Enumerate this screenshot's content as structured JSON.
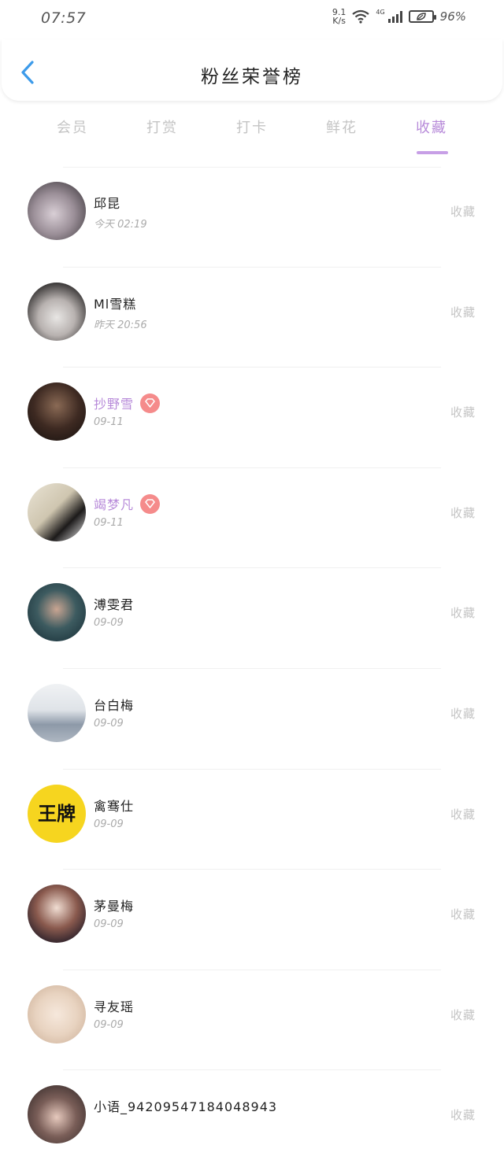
{
  "status_bar": {
    "time": "07:57",
    "net_speed_top": "9.1",
    "net_speed_bottom": "K/s",
    "network": "4G",
    "battery": "96%"
  },
  "header": {
    "title": "粉丝荣誉榜",
    "back_icon": "chevron-left-icon"
  },
  "tabs": [
    {
      "label": "会员"
    },
    {
      "label": "打赏"
    },
    {
      "label": "打卡"
    },
    {
      "label": "鲜花"
    },
    {
      "label": "收藏"
    }
  ],
  "active_tab": "收藏",
  "colors": {
    "accent": "#b78ad9",
    "badge": "#f58b8b",
    "back": "#3d9bea"
  },
  "list": [
    {
      "name": "邱昆",
      "time": "今天 02:19",
      "action": "收藏",
      "vip": false,
      "avatar_color": "#8a8090"
    },
    {
      "name": "Ml雪糕",
      "time": "昨天 20:56",
      "action": "收藏",
      "vip": false,
      "avatar_color": "#6f6a6a"
    },
    {
      "name": "抄野雪",
      "time": "09-11",
      "action": "收藏",
      "vip": true,
      "avatar_color": "#3a2b22"
    },
    {
      "name": "竭梦凡",
      "time": "09-11",
      "action": "收藏",
      "vip": true,
      "avatar_color": "#cfc8b8"
    },
    {
      "name": "溥雯君",
      "time": "09-09",
      "action": "收藏",
      "vip": false,
      "avatar_color": "#1f3a44"
    },
    {
      "name": "台白梅",
      "time": "09-09",
      "action": "收藏",
      "vip": false,
      "avatar_color": "#c8ced8"
    },
    {
      "name": "禽骞仕",
      "time": "09-09",
      "action": "收藏",
      "vip": false,
      "avatar_color": "#f6d51f"
    },
    {
      "name": "茅曼梅",
      "time": "09-09",
      "action": "收藏",
      "vip": false,
      "avatar_color": "#8a5a4e"
    },
    {
      "name": "寻友瑶",
      "time": "09-09",
      "action": "收藏",
      "vip": false,
      "avatar_color": "#e8d3c0"
    },
    {
      "name": "小语_94209547184048943",
      "time": "",
      "action": "收藏",
      "vip": false,
      "avatar_color": "#5a4a48"
    }
  ]
}
